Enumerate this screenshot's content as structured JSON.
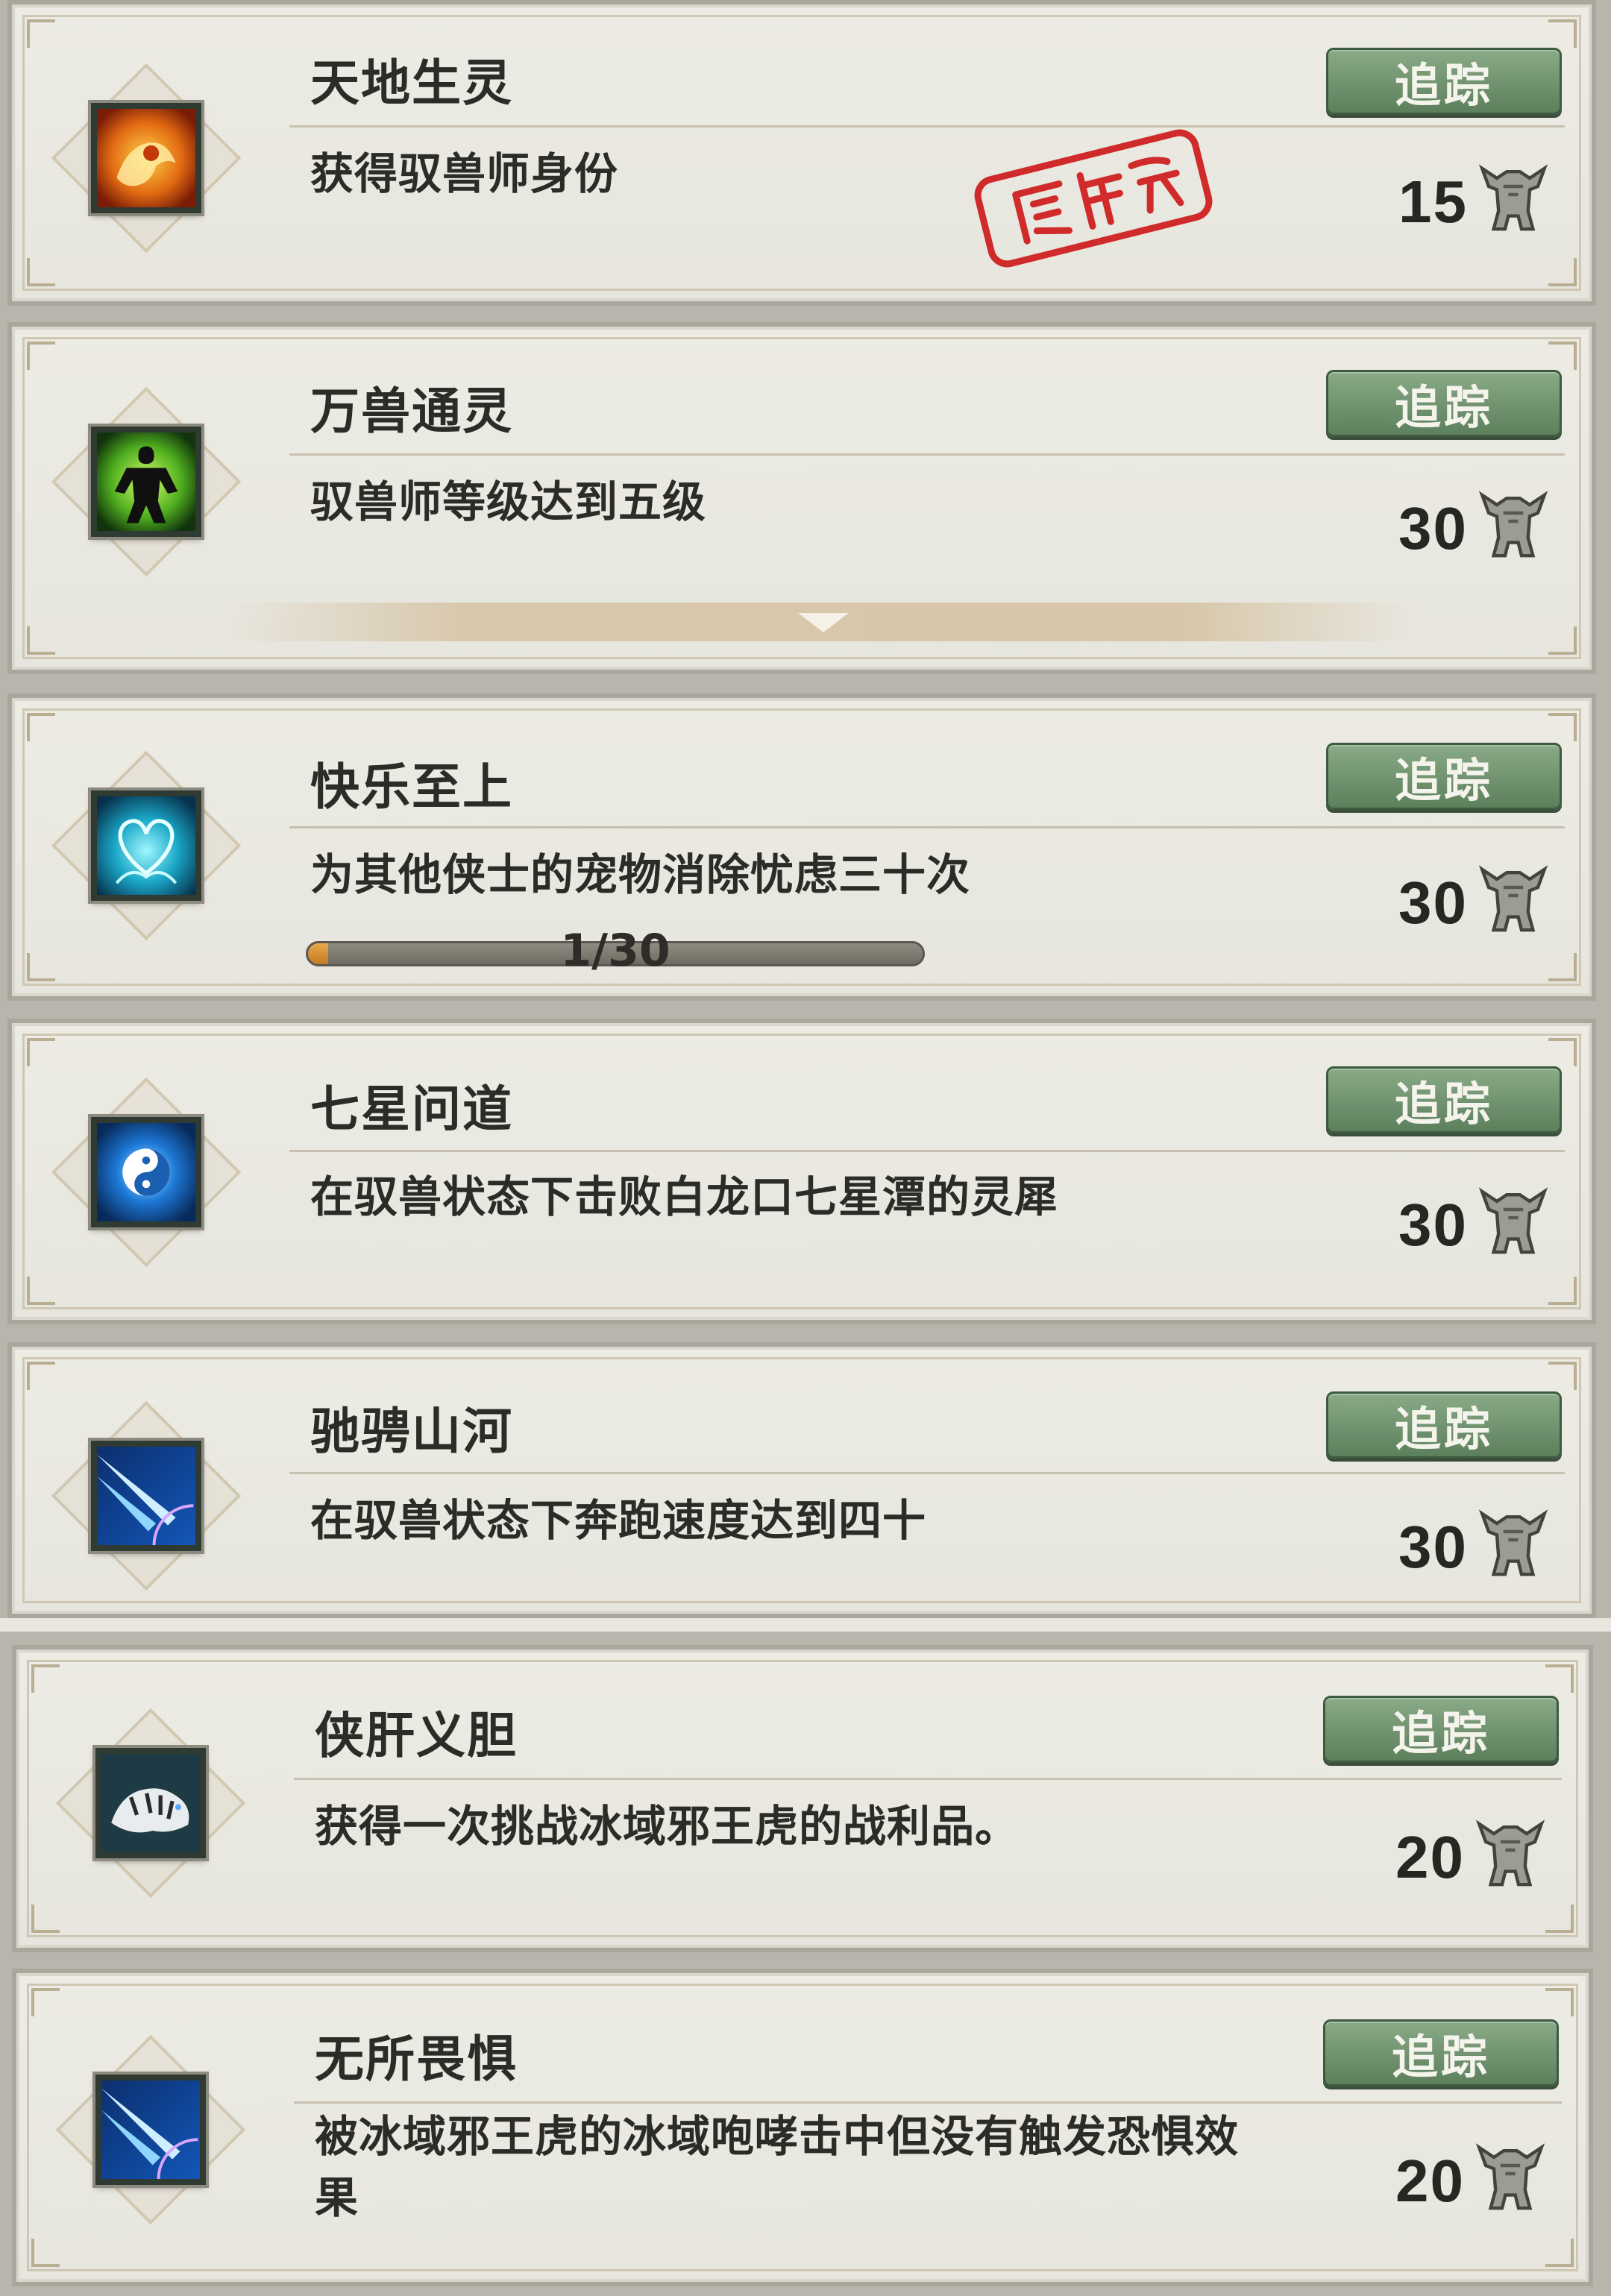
{
  "track_label": "追踪",
  "achievements": [
    {
      "title": "天地生灵",
      "desc": "获得驭兽师身份",
      "reward": "15",
      "icon": "golden-lion-icon",
      "status": "completed-stamp"
    },
    {
      "title": "万兽通灵",
      "desc": "驭兽师等级达到五级",
      "reward": "30",
      "icon": "shadow-beast-master-icon"
    },
    {
      "title": "快乐至上",
      "desc": "为其他侠士的宠物消除忧虑三十次",
      "reward": "30",
      "icon": "spirit-heart-icon",
      "progress": {
        "text": "1/30",
        "current": 1,
        "total": 30
      }
    },
    {
      "title": "七星问道",
      "desc": "在驭兽状态下击败白龙口七星潭的灵犀",
      "reward": "30",
      "icon": "yin-yang-icon"
    },
    {
      "title": "驰骋山河",
      "desc": "在驭兽状态下奔跑速度达到四十",
      "reward": "30",
      "icon": "light-streak-icon"
    },
    {
      "title": "侠肝义胆",
      "desc": "获得一次挑战冰域邪王虎的战利品。",
      "reward": "20",
      "icon": "white-tiger-icon"
    },
    {
      "title": "无所畏惧",
      "desc": "被冰域邪王虎的冰域咆哮击中但没有触发恐惧效果",
      "reward": "20",
      "icon": "light-streak-icon"
    }
  ],
  "colors": {
    "button_green": "#6f916d",
    "stamp_red": "#d02a2a",
    "progress_orange": "#e19a3c"
  }
}
